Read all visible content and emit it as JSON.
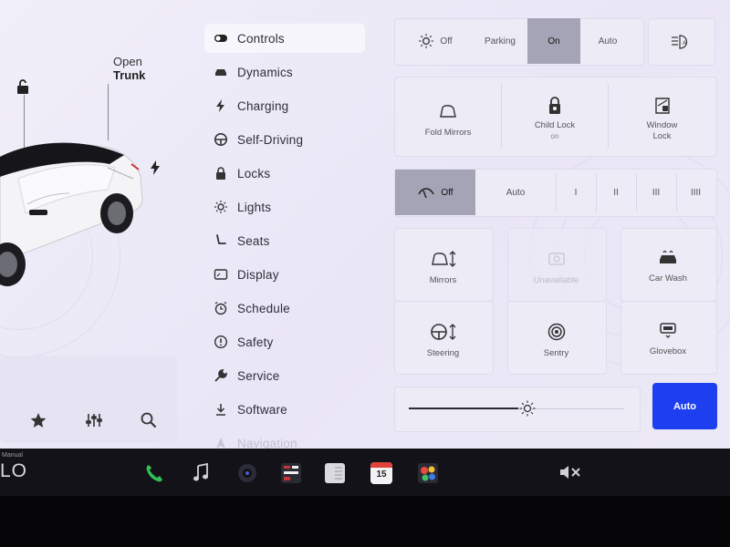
{
  "car_pane": {
    "trunk_line1": "Open",
    "trunk_line2": "Trunk",
    "icons": [
      "unlocked-padlock-icon",
      "charge-bolt-icon",
      "star-icon",
      "sliders-icon",
      "search-icon"
    ]
  },
  "menu": {
    "items": [
      {
        "label": "Controls",
        "icon": "toggle-icon"
      },
      {
        "label": "Dynamics",
        "icon": "car-icon"
      },
      {
        "label": "Charging",
        "icon": "bolt-icon"
      },
      {
        "label": "Self-Driving",
        "icon": "steering-wheel-icon"
      },
      {
        "label": "Locks",
        "icon": "lock-icon"
      },
      {
        "label": "Lights",
        "icon": "sun-icon"
      },
      {
        "label": "Seats",
        "icon": "seat-icon"
      },
      {
        "label": "Display",
        "icon": "display-icon"
      },
      {
        "label": "Schedule",
        "icon": "alarm-clock-icon"
      },
      {
        "label": "Safety",
        "icon": "alert-circle-icon"
      },
      {
        "label": "Service",
        "icon": "wrench-icon"
      },
      {
        "label": "Software",
        "icon": "download-icon"
      },
      {
        "label": "Navigation",
        "icon": "navigation-icon"
      }
    ],
    "active_index": 0
  },
  "lights": {
    "options": [
      "Off",
      "Parking",
      "On",
      "Auto"
    ],
    "selected": "On"
  },
  "tiles_row1": {
    "fold_mirrors": "Fold Mirrors",
    "child_lock": "Child Lock",
    "child_lock_state": "on",
    "window_lock_1": "Window",
    "window_lock_2": "Lock"
  },
  "wipers": {
    "off": "Off",
    "auto": "Auto",
    "speeds": [
      "I",
      "II",
      "III",
      "IIII"
    ],
    "selected": "Off"
  },
  "tiles_grid": {
    "mirrors": "Mirrors",
    "unavailable": "Unavailable",
    "car_wash": "Car Wash",
    "steering": "Steering",
    "sentry": "Sentry",
    "glovebox": "Glovebox"
  },
  "brightness": {
    "level": 0.55,
    "auto_label": "Auto"
  },
  "taskbar": {
    "gear_small": "Manual",
    "gear": "LO",
    "calendar_day": "15",
    "apps": [
      "phone-icon",
      "music-icon",
      "camera-icon",
      "media-icon",
      "notes-icon",
      "calendar-icon",
      "toybox-icon"
    ],
    "volume": "muted",
    "accent": "#1d3ff0"
  }
}
